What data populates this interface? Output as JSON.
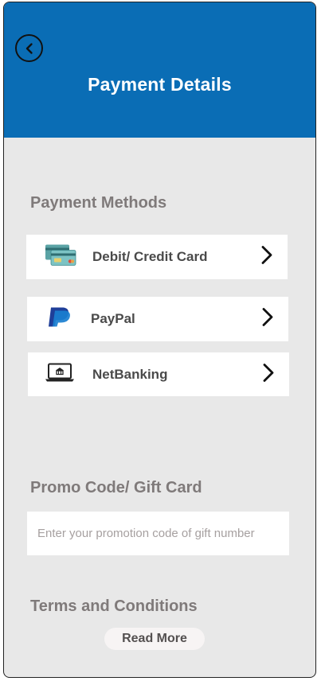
{
  "header": {
    "title": "Payment Details",
    "back_icon": "chevron-left-icon",
    "background": "#0a6db5"
  },
  "payment_methods": {
    "heading": "Payment Methods",
    "items": [
      {
        "label": "Debit/ Credit Card",
        "icon": "credit-card-icon"
      },
      {
        "label": "PayPal",
        "icon": "paypal-icon"
      },
      {
        "label": "NetBanking",
        "icon": "netbanking-laptop-icon"
      }
    ]
  },
  "promo": {
    "heading": "Promo Code/ Gift Card",
    "placeholder": "Enter your promotion code of gift number",
    "value": ""
  },
  "terms": {
    "heading": "Terms and Conditions",
    "read_more_label": "Read More"
  },
  "colors": {
    "brand_blue": "#0a6db5",
    "panel_bg": "#e8e8e8",
    "heading_gray": "#7f7a7a"
  }
}
